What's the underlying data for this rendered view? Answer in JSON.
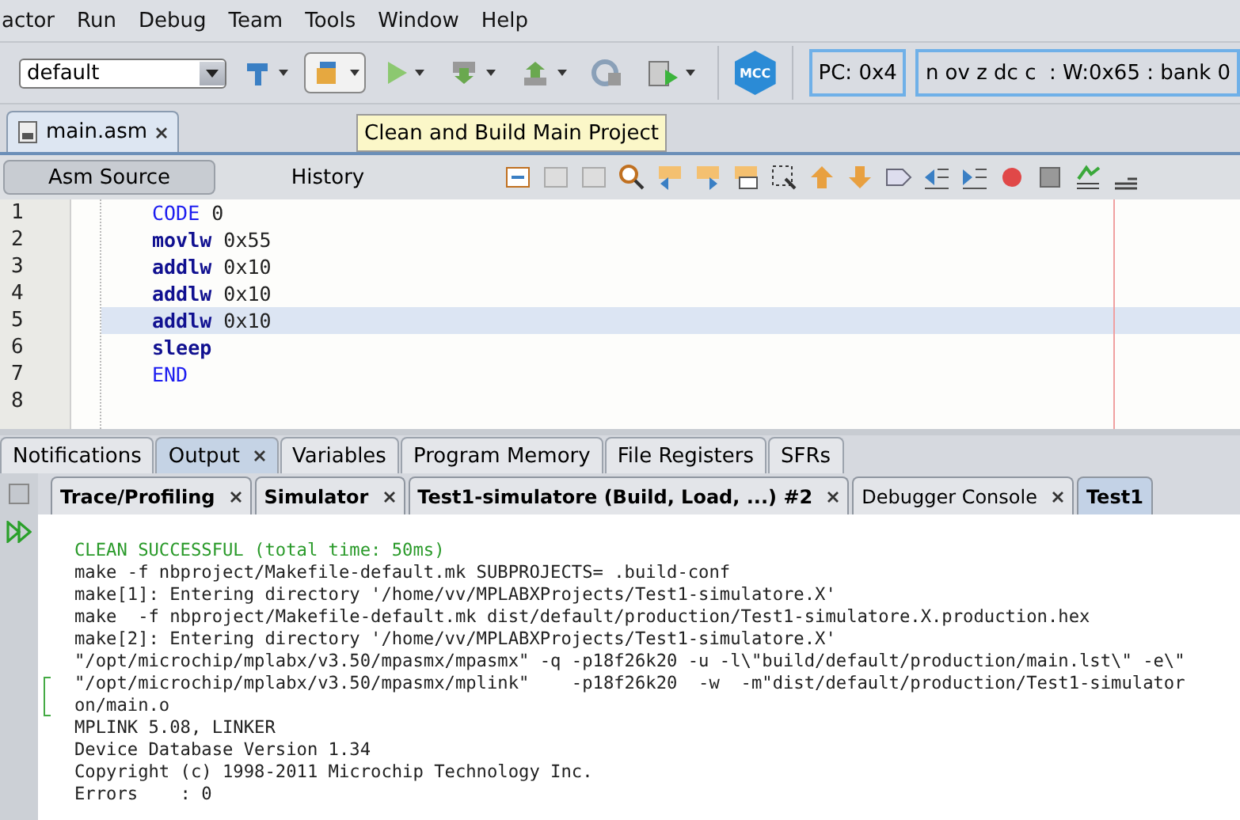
{
  "menu": [
    "actor",
    "Run",
    "Debug",
    "Team",
    "Tools",
    "Window",
    "Help"
  ],
  "toolbar": {
    "configuration": "default",
    "logo": "MCC",
    "pc": "PC: 0x4",
    "status": "n ov z dc c  : W:0x65 : bank 0"
  },
  "editor_tabs": [
    {
      "label": "main.asm",
      "selected": true
    }
  ],
  "tooltip": "Clean and Build Main Project",
  "view_tabs": [
    {
      "label": "Asm Source",
      "selected": true
    },
    {
      "label": "History",
      "selected": false
    }
  ],
  "code_lines": [
    {
      "number": "1",
      "keyword": "CODE",
      "operand": "0",
      "kind": "directive",
      "current": false
    },
    {
      "number": "2",
      "keyword": "movlw",
      "operand": "0x55",
      "kind": "instruction",
      "current": false
    },
    {
      "number": "3",
      "keyword": "addlw",
      "operand": "0x10",
      "kind": "instruction",
      "current": false
    },
    {
      "number": "4",
      "keyword": "addlw",
      "operand": "0x10",
      "kind": "instruction",
      "current": false
    },
    {
      "number": "5",
      "keyword": "addlw",
      "operand": "0x10",
      "kind": "instruction",
      "current": true
    },
    {
      "number": "6",
      "keyword": "sleep",
      "kind": "instruction",
      "current": false
    },
    {
      "number": "7",
      "keyword": "END",
      "kind": "directive",
      "current": false
    },
    {
      "number": "8",
      "current": false
    }
  ],
  "bottom_tabs": [
    {
      "label": "Notifications",
      "selected": false,
      "closable": false
    },
    {
      "label": "Output",
      "selected": true,
      "closable": true
    },
    {
      "label": "Variables",
      "selected": false,
      "closable": false
    },
    {
      "label": "Program Memory",
      "selected": false,
      "closable": false
    },
    {
      "label": "File Registers",
      "selected": false,
      "closable": false
    },
    {
      "label": "SFRs",
      "selected": false,
      "closable": false
    }
  ],
  "output_tabs": [
    {
      "label": "Trace/Profiling",
      "unread": true,
      "selected": false,
      "closable": true
    },
    {
      "label": "Simulator",
      "unread": true,
      "selected": false,
      "closable": true
    },
    {
      "label": "Test1-simulatore (Build, Load, ...) #2",
      "unread": true,
      "selected": false,
      "closable": true
    },
    {
      "label": "Debugger Console",
      "unread": false,
      "selected": false,
      "closable": true
    },
    {
      "label": "Test1",
      "unread": true,
      "selected": true,
      "closable": false
    }
  ],
  "output_lines": [
    {
      "text": "CLEAN SUCCESSFUL (total time: 50ms)",
      "kind": "success"
    },
    {
      "text": "make -f nbproject/Makefile-default.mk SUBPROJECTS= .build-conf",
      "kind": "normal"
    },
    {
      "text": "make[1]: Entering directory '/home/vv/MPLABXProjects/Test1-simulatore.X'",
      "kind": "normal"
    },
    {
      "text": "make  -f nbproject/Makefile-default.mk dist/default/production/Test1-simulatore.X.production.hex",
      "kind": "normal"
    },
    {
      "text": "make[2]: Entering directory '/home/vv/MPLABXProjects/Test1-simulatore.X'",
      "kind": "normal"
    },
    {
      "text": "\"/opt/microchip/mplabx/v3.50/mpasmx/mpasmx\" -q -p18f26k20 -u -l\\\"build/default/production/main.lst\\\" -e\\\"",
      "kind": "normal"
    },
    {
      "text": "\"/opt/microchip/mplabx/v3.50/mpasmx/mplink\"    -p18f26k20  -w  -m\"dist/default/production/Test1-simulator",
      "kind": "folded"
    },
    {
      "text": "on/main.o",
      "kind": "continued"
    },
    {
      "text": "MPLINK 5.08, LINKER",
      "kind": "normal"
    },
    {
      "text": "Device Database Version 1.34",
      "kind": "normal"
    },
    {
      "text": "Copyright (c) 1998-2011 Microchip Technology Inc.",
      "kind": "normal"
    },
    {
      "text": "Errors    : 0",
      "kind": "normal"
    }
  ]
}
